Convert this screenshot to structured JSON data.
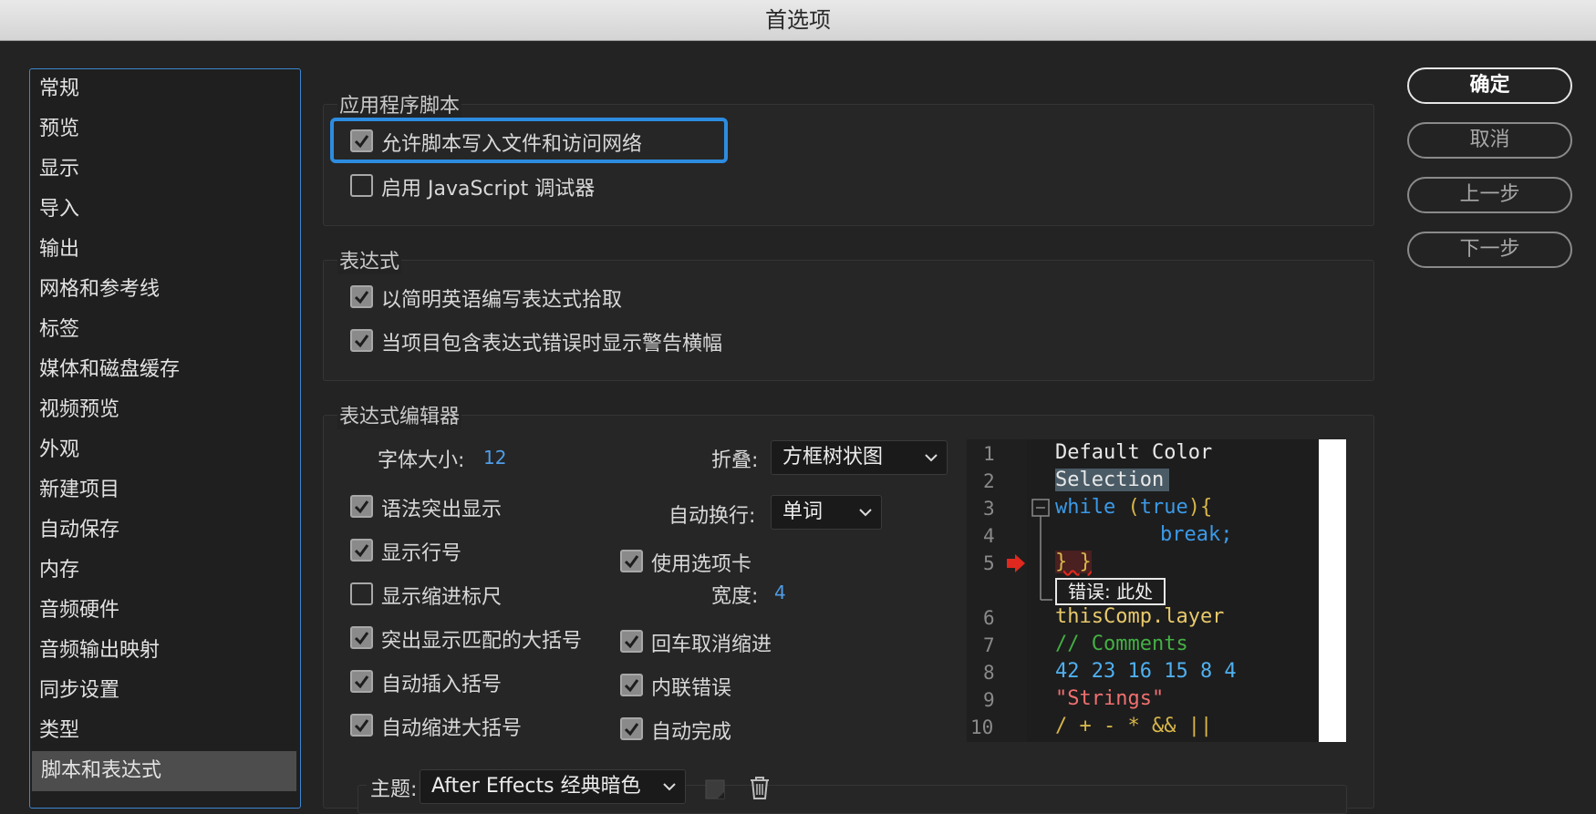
{
  "window": {
    "title": "首选项"
  },
  "sidebar": {
    "items": [
      {
        "label": "常规"
      },
      {
        "label": "预览"
      },
      {
        "label": "显示"
      },
      {
        "label": "导入"
      },
      {
        "label": "输出"
      },
      {
        "label": "网格和参考线"
      },
      {
        "label": "标签"
      },
      {
        "label": "媒体和磁盘缓存"
      },
      {
        "label": "视频预览"
      },
      {
        "label": "外观"
      },
      {
        "label": "新建项目"
      },
      {
        "label": "自动保存"
      },
      {
        "label": "内存"
      },
      {
        "label": "音频硬件"
      },
      {
        "label": "音频输出映射"
      },
      {
        "label": "同步设置"
      },
      {
        "label": "类型"
      },
      {
        "label": "脚本和表达式",
        "selected": true
      }
    ]
  },
  "buttons": {
    "ok": "确定",
    "cancel": "取消",
    "prev": "上一步",
    "next": "下一步"
  },
  "app_scripts": {
    "title": "应用程序脚本",
    "allow_write": {
      "label": "允许脚本写入文件和访问网络",
      "checked": true
    },
    "js_debugger": {
      "label": "启用 JavaScript 调试器",
      "checked": false
    }
  },
  "expressions": {
    "title": "表达式",
    "pick_whip": {
      "label": "以简明英语编写表达式拾取",
      "checked": true
    },
    "warn_banner": {
      "label": "当项目包含表达式错误时显示警告横幅",
      "checked": true
    }
  },
  "editor": {
    "title": "表达式编辑器",
    "font_size_label": "字体大小:",
    "font_size_value": "12",
    "fold_label": "折叠:",
    "fold_value": "方框树状图",
    "wrap_label": "自动换行:",
    "wrap_value": "单词",
    "syntax_highlight": {
      "label": "语法突出显示",
      "checked": true
    },
    "line_numbers": {
      "label": "显示行号",
      "checked": true
    },
    "indent_guides": {
      "label": "显示缩进标尺",
      "checked": false
    },
    "match_brackets": {
      "label": "突出显示匹配的大括号",
      "checked": true
    },
    "auto_brackets": {
      "label": "自动插入括号",
      "checked": true
    },
    "auto_indent": {
      "label": "自动缩进大括号",
      "checked": true
    },
    "use_tabs": {
      "label": "使用选项卡",
      "checked": true
    },
    "tab_width_label": "宽度:",
    "tab_width_value": "4",
    "enter_unindent": {
      "label": "回车取消缩进",
      "checked": true
    },
    "inline_errors": {
      "label": "内联错误",
      "checked": true
    },
    "autocomplete": {
      "label": "自动完成",
      "checked": true
    },
    "theme_label": "主题:",
    "theme_value": "After Effects 经典暗色"
  },
  "preview": {
    "line_numbers": [
      "1",
      "2",
      "3",
      "4",
      "5",
      "6",
      "7",
      "8",
      "9",
      "10"
    ],
    "l1": "Default Color",
    "l2": "Selection",
    "l3_kw": "while",
    "l3_paren1": " (",
    "l3_true": "true",
    "l3_rest": "){",
    "l4": "break;",
    "l5": "} }",
    "error_text": "错误: 此处",
    "l6": "thisComp.layer",
    "l7": "// Comments",
    "l8": "42 23 16 15 8 4",
    "l9": "\"Strings\"",
    "l10": "/ + - * && ||",
    "colors": {
      "default": "#e8e8e8",
      "keyword": "#3b9ae8",
      "paren": "#d8b64a",
      "comment": "#44b044",
      "number": "#4fb0f0",
      "string": "#f07070",
      "error_arrow": "#e0281e"
    }
  }
}
